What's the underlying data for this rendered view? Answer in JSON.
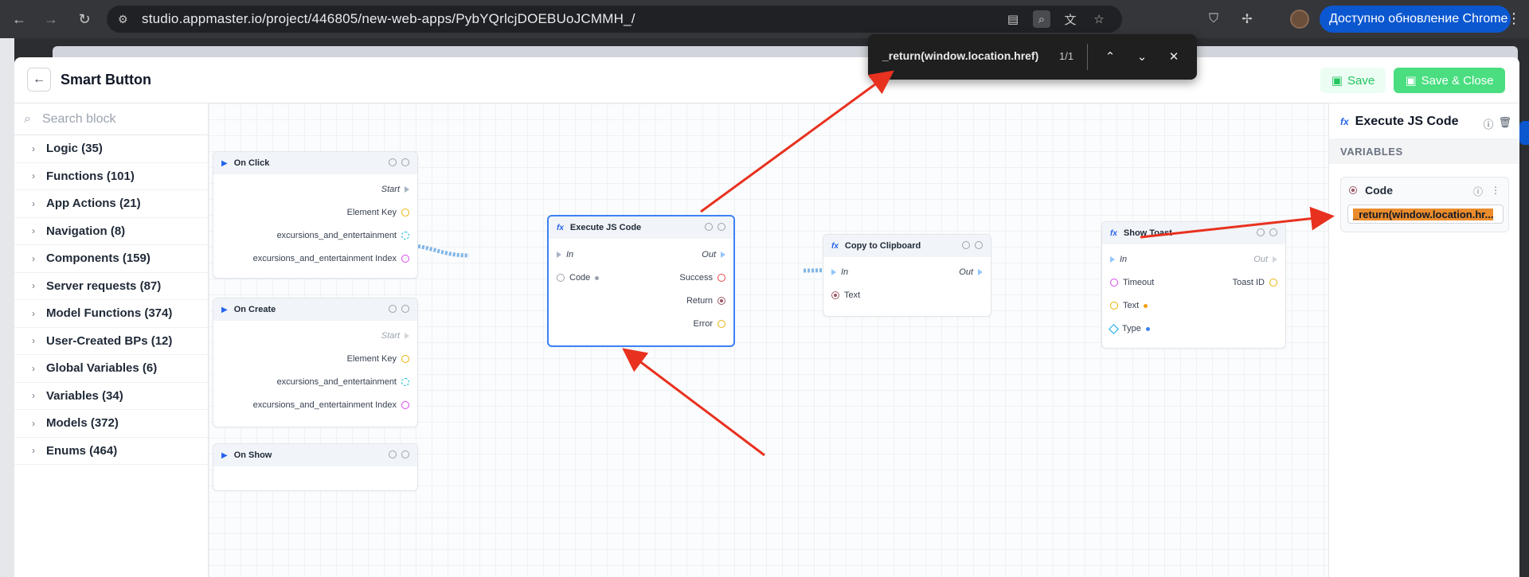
{
  "browser": {
    "url": "studio.appmaster.io/project/446805/new-web-apps/PybYQrlcjDOEBUoJCMMH_/",
    "update_label": "Доступно обновление Chrome"
  },
  "find_bar": {
    "query": "_return(window.location.href)",
    "count": "1/1"
  },
  "header": {
    "title": "Smart Button",
    "save_label": "Save",
    "save_close_label": "Save & Close"
  },
  "left_panel": {
    "search_placeholder": "Search block",
    "categories": [
      "Logic (35)",
      "Functions (101)",
      "App Actions (21)",
      "Navigation (8)",
      "Components (159)",
      "Server requests (87)",
      "Model Functions (374)",
      "User-Created BPs (12)",
      "Global Variables (6)",
      "Variables (34)",
      "Models (372)",
      "Enums (464)"
    ]
  },
  "nodes": {
    "on_click": {
      "title": "On Click",
      "start": "Start",
      "element_key": "Element Key",
      "item": "excursions_and_entertainment",
      "item_index": "excursions_and_entertainment Index"
    },
    "on_create": {
      "title": "On Create",
      "start": "Start",
      "element_key": "Element Key",
      "item": "excursions_and_entertainment",
      "item_index": "excursions_and_entertainment Index"
    },
    "on_show": {
      "title": "On Show"
    },
    "execute_js": {
      "title": "Execute JS Code",
      "in": "In",
      "out": "Out",
      "code": "Code",
      "success": "Success",
      "return": "Return",
      "error": "Error"
    },
    "copy_clipboard": {
      "title": "Copy to Clipboard",
      "in": "In",
      "out": "Out",
      "text": "Text"
    },
    "show_toast": {
      "title": "Show Toast",
      "in": "In",
      "out": "Out",
      "timeout": "Timeout",
      "toast_id": "Toast ID",
      "text": "Text",
      "type": "Type"
    }
  },
  "right_panel": {
    "title": "Execute JS Code",
    "section": "VARIABLES",
    "variable_name": "Code",
    "variable_value": "_return(window.location.hr..."
  },
  "colors": {
    "accent_blue": "#3b82f6",
    "save_green": "#4ade80",
    "arrow_red": "#e8311f",
    "highlight_orange": "#ea8c2c"
  }
}
